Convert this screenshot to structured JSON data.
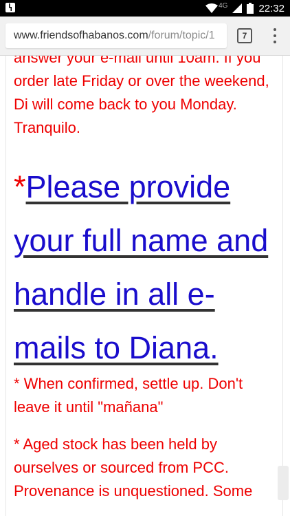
{
  "status": {
    "network": "4G",
    "time": "22:32"
  },
  "browser": {
    "url_domain": "www.friendsofhabanos.com",
    "url_path": "/forum/topic/1",
    "tab_count": "7"
  },
  "content": {
    "para1": "answer your e-mail until 10am. If you order late Friday or over the weekend, Di will come back to you Monday. Tranquilo.",
    "big_star": "*",
    "big_link": "Please provide your full name and handle  in all e-mails to Diana.",
    "para2": "* When confirmed, settle up. Don't leave it until \"mañana\"",
    "para3": "*  Aged stock has been held by ourselves or sourced from PCC. Provenance is unquestioned. Some"
  }
}
